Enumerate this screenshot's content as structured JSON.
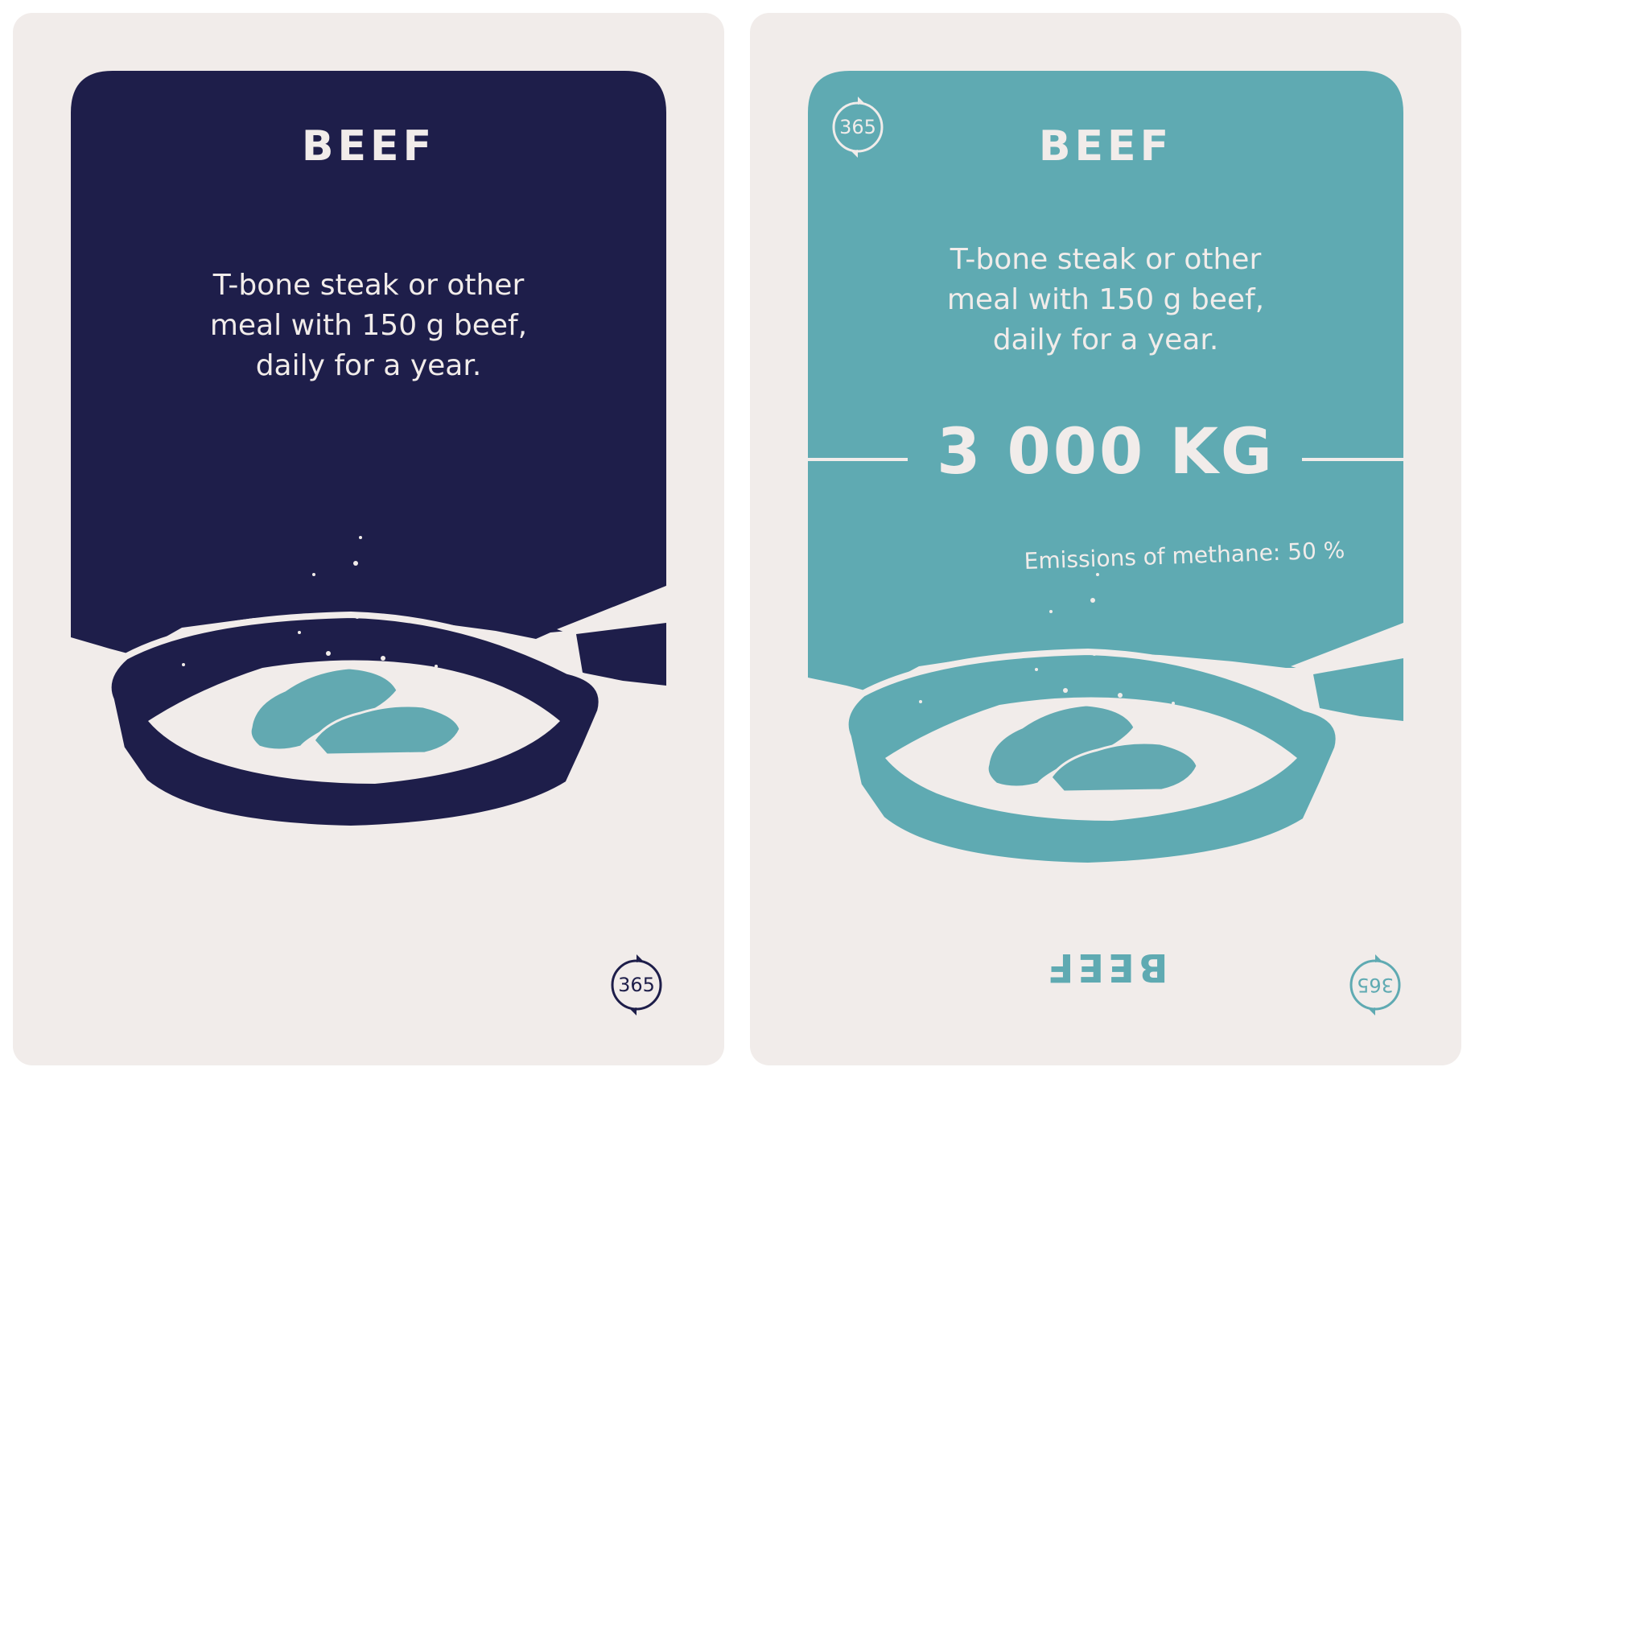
{
  "colors": {
    "navy": "#1e1e4a",
    "teal": "#5faab2",
    "card_background": "#f1ecea",
    "steak": "#62a9b1"
  },
  "front_card": {
    "title": "BEEF",
    "description_lines": [
      "T-bone steak or other",
      "meal with 150 g beef,",
      "daily for a year."
    ],
    "badge": "365"
  },
  "back_card": {
    "title": "BEEF",
    "description_lines": [
      "T-bone steak or other",
      "meal with 150 g beef,",
      "daily for a year."
    ],
    "amount": "3 000 KG",
    "methane": "Emissions of methane: 50 %",
    "mirrored_title": "BEEF",
    "badge_top": "365",
    "badge_bottom": "365"
  }
}
